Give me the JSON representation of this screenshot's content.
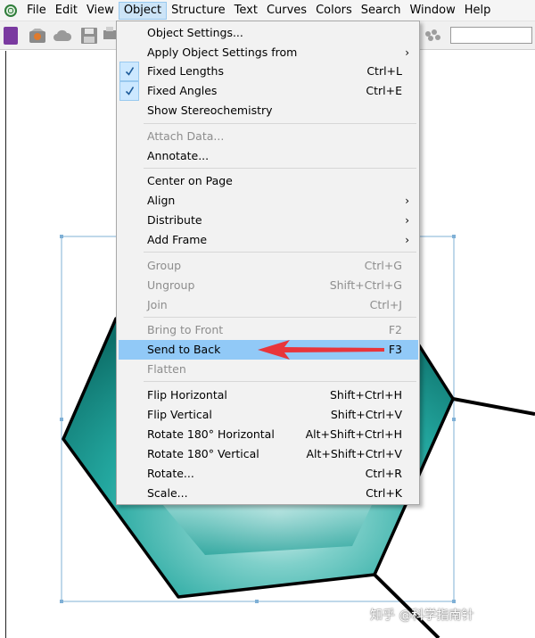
{
  "menubar": {
    "items": [
      {
        "label": "File"
      },
      {
        "label": "Edit"
      },
      {
        "label": "View"
      },
      {
        "label": "Object",
        "active": true
      },
      {
        "label": "Structure"
      },
      {
        "label": "Text"
      },
      {
        "label": "Curves"
      },
      {
        "label": "Colors"
      },
      {
        "label": "Search"
      },
      {
        "label": "Window"
      },
      {
        "label": "Help"
      }
    ]
  },
  "object_menu": {
    "items": [
      {
        "label": "Object Settings...",
        "shortcut": "",
        "checked": false,
        "disabled": false,
        "submenu": false
      },
      {
        "label": "Apply Object Settings from",
        "shortcut": "",
        "checked": false,
        "disabled": false,
        "submenu": true
      },
      {
        "label": "Fixed Lengths",
        "shortcut": "Ctrl+L",
        "checked": true,
        "disabled": false,
        "submenu": false
      },
      {
        "label": "Fixed Angles",
        "shortcut": "Ctrl+E",
        "checked": true,
        "disabled": false,
        "submenu": false
      },
      {
        "label": "Show Stereochemistry",
        "shortcut": "",
        "checked": false,
        "disabled": false,
        "submenu": false
      },
      {
        "label": "Attach Data...",
        "shortcut": "",
        "checked": false,
        "disabled": true,
        "submenu": false
      },
      {
        "label": "Annotate...",
        "shortcut": "",
        "checked": false,
        "disabled": false,
        "submenu": false
      },
      {
        "label": "Center on Page",
        "shortcut": "",
        "checked": false,
        "disabled": false,
        "submenu": false
      },
      {
        "label": "Align",
        "shortcut": "",
        "checked": false,
        "disabled": false,
        "submenu": true
      },
      {
        "label": "Distribute",
        "shortcut": "",
        "checked": false,
        "disabled": false,
        "submenu": true
      },
      {
        "label": "Add Frame",
        "shortcut": "",
        "checked": false,
        "disabled": false,
        "submenu": true
      },
      {
        "label": "Group",
        "shortcut": "Ctrl+G",
        "checked": false,
        "disabled": true,
        "submenu": false
      },
      {
        "label": "Ungroup",
        "shortcut": "Shift+Ctrl+G",
        "checked": false,
        "disabled": true,
        "submenu": false
      },
      {
        "label": "Join",
        "shortcut": "Ctrl+J",
        "checked": false,
        "disabled": true,
        "submenu": false
      },
      {
        "label": "Bring to Front",
        "shortcut": "F2",
        "checked": false,
        "disabled": true,
        "submenu": false
      },
      {
        "label": "Send to Back",
        "shortcut": "F3",
        "checked": false,
        "disabled": false,
        "submenu": false,
        "highlighted": true
      },
      {
        "label": "Flatten",
        "shortcut": "",
        "checked": false,
        "disabled": true,
        "submenu": false
      },
      {
        "label": "Flip Horizontal",
        "shortcut": "Shift+Ctrl+H",
        "checked": false,
        "disabled": false,
        "submenu": false
      },
      {
        "label": "Flip Vertical",
        "shortcut": "Shift+Ctrl+V",
        "checked": false,
        "disabled": false,
        "submenu": false
      },
      {
        "label": "Rotate 180° Horizontal",
        "shortcut": "Alt+Shift+Ctrl+H",
        "checked": false,
        "disabled": false,
        "submenu": false
      },
      {
        "label": "Rotate 180° Vertical",
        "shortcut": "Alt+Shift+Ctrl+V",
        "checked": false,
        "disabled": false,
        "submenu": false
      },
      {
        "label": "Rotate...",
        "shortcut": "Ctrl+R",
        "checked": false,
        "disabled": false,
        "submenu": false
      },
      {
        "label": "Scale...",
        "shortcut": "Ctrl+K",
        "checked": false,
        "disabled": false,
        "submenu": false
      }
    ]
  },
  "watermark": "知乎 @科学指南针",
  "colors": {
    "menu_highlight": "#91c9f7",
    "annotation_arrow": "#e8353b",
    "hexagon_fill": "#1a9e96",
    "selection_frame": "#7fb0d6"
  }
}
